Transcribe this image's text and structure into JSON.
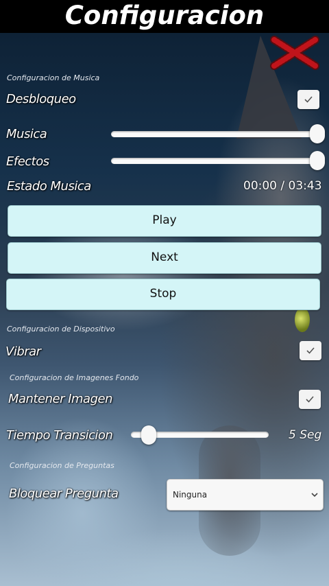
{
  "header": {
    "title": "Configuracion"
  },
  "music_section": {
    "heading": "Configuracion de Musica",
    "unlock_label": "Desbloqueo",
    "unlock_checked": true,
    "music_label": "Musica",
    "music_volume": 1.0,
    "effects_label": "Efectos",
    "effects_volume": 1.0,
    "status_label": "Estado Musica",
    "time": "00:00 / 03:43",
    "play_label": "Play",
    "next_label": "Next",
    "stop_label": "Stop"
  },
  "device_section": {
    "heading": "Configuracion de Dispositivo",
    "vibrate_label": "Vibrar",
    "vibrate_checked": true
  },
  "background_section": {
    "heading": "Configuracion de Imagenes Fondo",
    "keep_image_label": "Mantener Imagen",
    "keep_image_checked": true,
    "transition_label": "Tiempo Transicion",
    "transition_value": "5 Seg",
    "transition_fraction": 0.13
  },
  "questions_section": {
    "heading": "Configuracion de Preguntas",
    "block_label": "Bloquear Pregunta",
    "block_selected": "Ninguna"
  },
  "icons": {
    "close": "close-x-icon",
    "check": "checkmark-icon",
    "chevron": "chevron-down-icon"
  },
  "colors": {
    "button_bg": "#d4f5f7",
    "close_red": "#c0141b"
  }
}
